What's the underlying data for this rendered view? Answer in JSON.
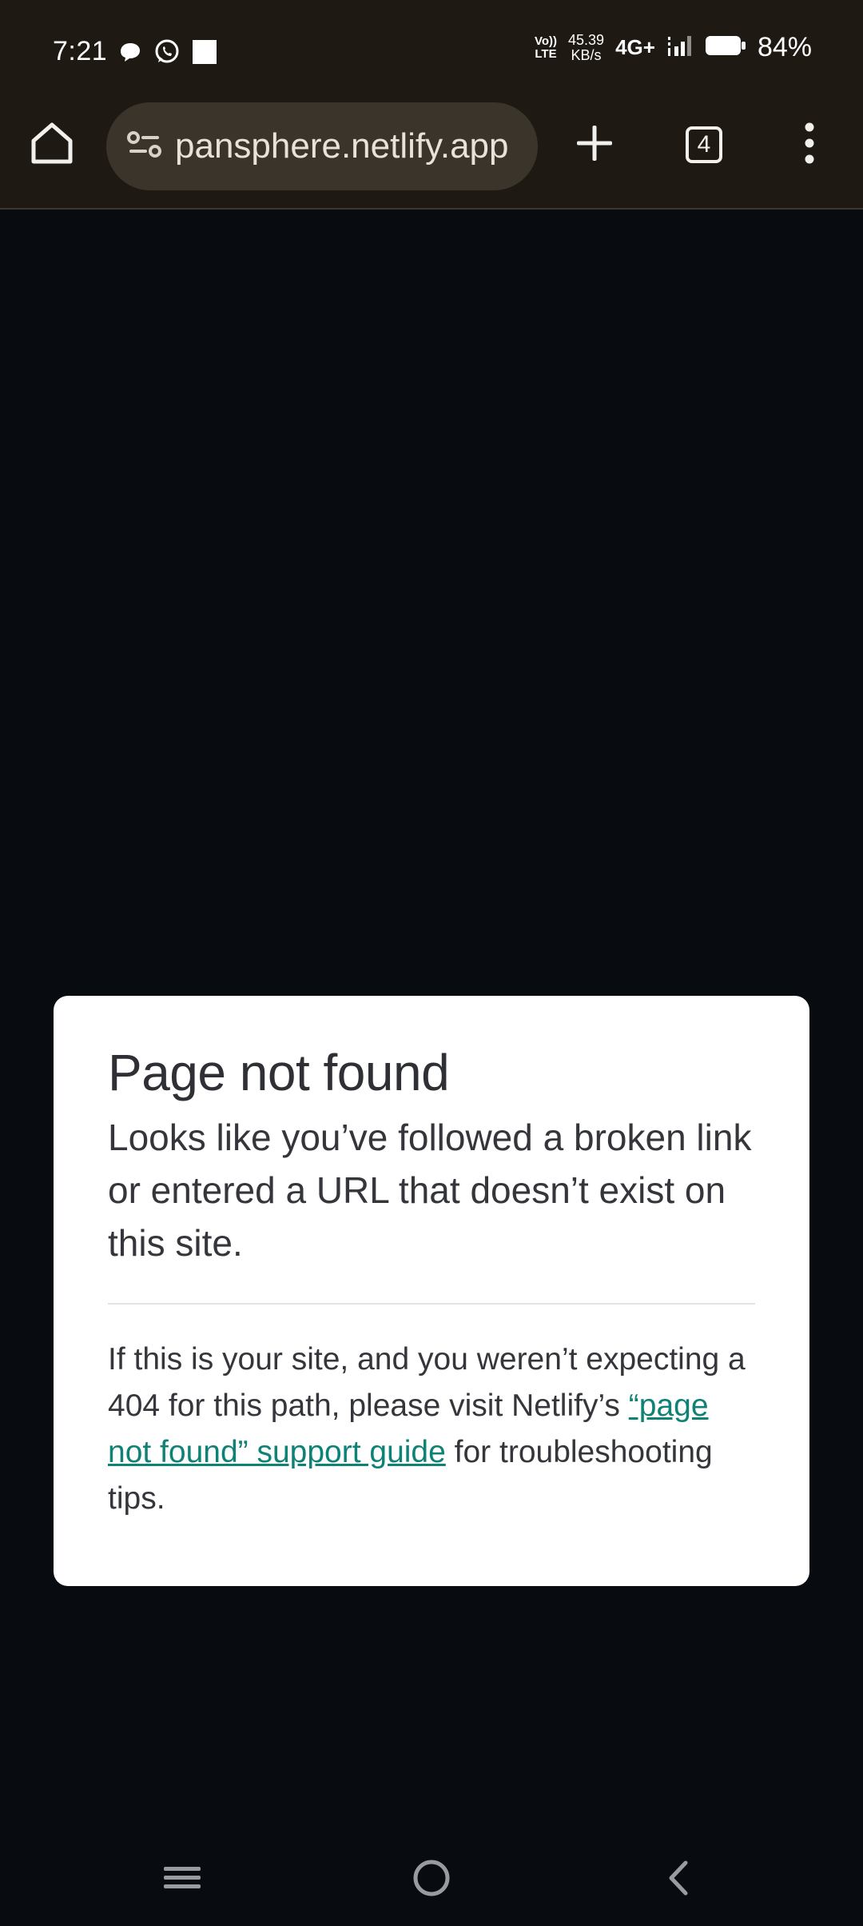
{
  "status_bar": {
    "time": "7:21",
    "volte_line1": "Vo))",
    "volte_line2": "LTE",
    "net_speed_value": "45.39",
    "net_speed_unit": "KB/s",
    "network_type": "4G+",
    "battery": "84%"
  },
  "browser": {
    "url": "pansphere.netlify.app",
    "tab_count": "4"
  },
  "error_page": {
    "title": "Page not found",
    "lead": "Looks like you’ve followed a broken link or entered a URL that doesn’t exist on this site.",
    "body_before": "If this is your site, and you weren’t expecting a 404 for this path, please visit Netlify’s ",
    "link_text": "“page not found” support guide",
    "body_after": " for troubleshooting tips."
  },
  "colors": {
    "toolbar_bg": "#1e1913",
    "page_bg": "#080c11",
    "link": "#0f8276"
  }
}
